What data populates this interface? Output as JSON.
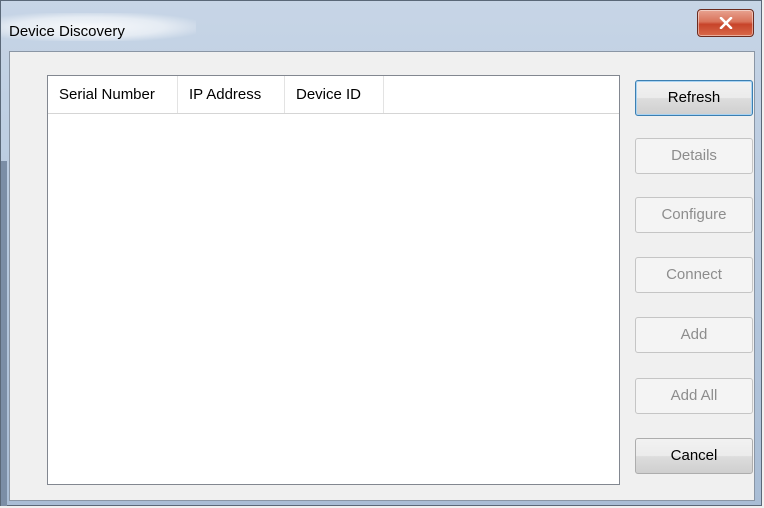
{
  "window": {
    "title": "Device Discovery",
    "close_icon": "close-icon",
    "colors": {
      "title_bar": "#b9cbe0",
      "close_button": "#c7442a",
      "client_bg": "#f0f0f0"
    }
  },
  "device_list": {
    "columns": [
      "Serial Number",
      "IP Address",
      "Device ID"
    ],
    "rows": []
  },
  "buttons": {
    "refresh": {
      "label": "Refresh",
      "enabled": true
    },
    "details": {
      "label": "Details",
      "enabled": false
    },
    "configure": {
      "label": "Configure",
      "enabled": false
    },
    "connect": {
      "label": "Connect",
      "enabled": false
    },
    "add": {
      "label": "Add",
      "enabled": false
    },
    "add_all": {
      "label": "Add All",
      "enabled": false
    },
    "cancel": {
      "label": "Cancel",
      "enabled": true
    }
  }
}
